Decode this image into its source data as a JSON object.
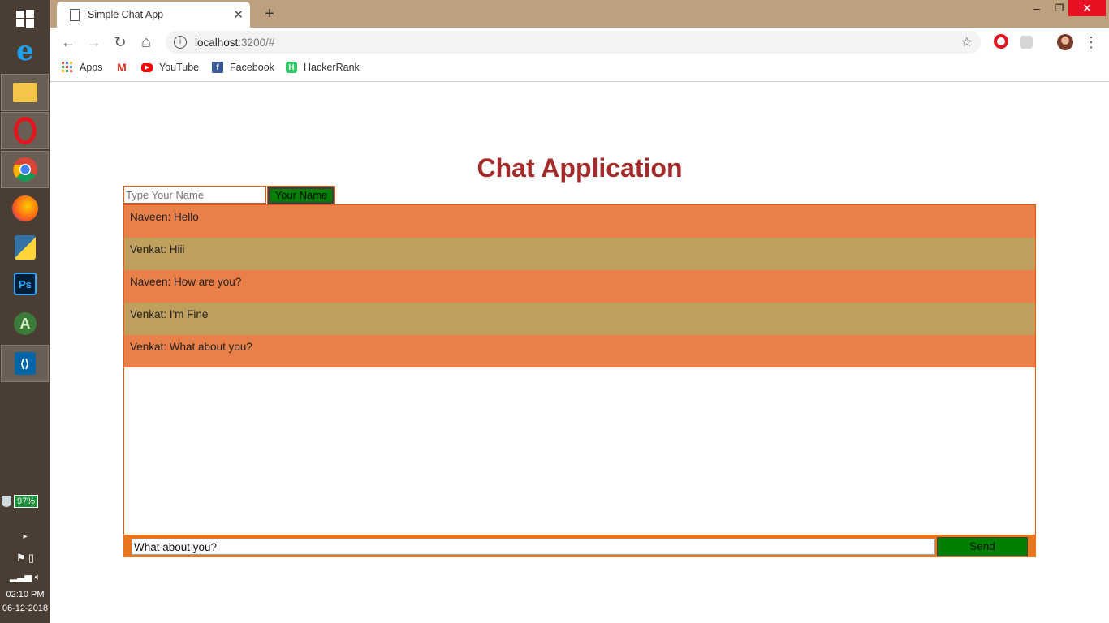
{
  "browser": {
    "tab_title": "Simple Chat App",
    "tab_close": "✕",
    "new_tab": "+",
    "url_host": "localhost",
    "url_path": ":3200/#",
    "win_min": "–",
    "win_restore": "❐",
    "win_close": "✕",
    "back": "←",
    "forward": "→",
    "reload": "↻",
    "home": "⌂",
    "star": "☆",
    "menu": "⋮"
  },
  "bookmarks": [
    {
      "label": "Apps",
      "icon": "apps-grid-icon",
      "color": "#4285f4"
    },
    {
      "label": "",
      "icon": "gmail-icon",
      "color": "#d93025"
    },
    {
      "label": "YouTube",
      "icon": "youtube-icon",
      "color": "#ff0000"
    },
    {
      "label": "Facebook",
      "icon": "facebook-icon",
      "color": "#3b5998"
    },
    {
      "label": "HackerRank",
      "icon": "hackerrank-icon",
      "color": "#2ec866"
    }
  ],
  "taskbar": {
    "battery": "97%",
    "time": "02:10 PM",
    "date": "06-12-2018",
    "apps": [
      {
        "name": "windows-start-icon",
        "color": "#ffffff"
      },
      {
        "name": "internet-explorer-icon",
        "color": "#1ea1f1"
      },
      {
        "name": "file-explorer-icon",
        "color": "#f3c64a"
      },
      {
        "name": "opera-icon",
        "color": "#e0171f"
      },
      {
        "name": "chrome-icon",
        "color": "#4caf50"
      },
      {
        "name": "firefox-icon",
        "color": "#ff7a1a"
      },
      {
        "name": "python-icon",
        "color": "#3572a5"
      },
      {
        "name": "photoshop-icon",
        "color": "#001e36"
      },
      {
        "name": "android-studio-icon",
        "color": "#78c257"
      },
      {
        "name": "vscode-icon",
        "color": "#0065a9"
      }
    ]
  },
  "app": {
    "title": "Chat Application",
    "name_placeholder": "Type Your Name",
    "name_button": "Your Name",
    "messages": [
      "Naveen: Hello",
      "Venkat: Hiii",
      "Naveen: How are you?",
      "Venkat: I'm Fine",
      "Venkat: What about you?"
    ],
    "message_value": "What about you?",
    "send_label": "Send"
  }
}
